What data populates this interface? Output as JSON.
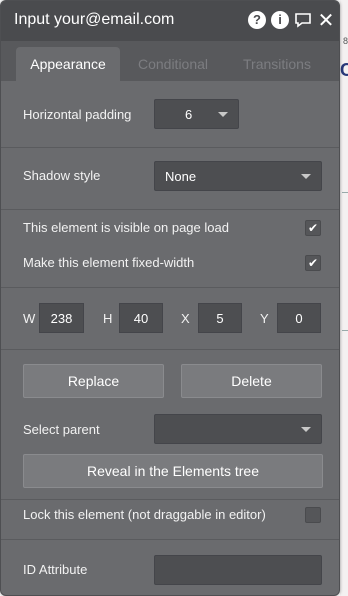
{
  "panel": {
    "title": "Input your@email.com",
    "icons": [
      "help-icon",
      "info-icon",
      "comment-icon",
      "close-icon"
    ]
  },
  "tabs": [
    {
      "label": "Appearance",
      "active": true
    },
    {
      "label": "Conditional",
      "active": false
    },
    {
      "label": "Transitions",
      "active": false
    }
  ],
  "appearance": {
    "horizontal_padding": {
      "label": "Horizontal padding",
      "value": "6"
    },
    "shadow_style": {
      "label": "Shadow style",
      "value": "None"
    },
    "visible_on_load": {
      "label": "This element is visible on page load",
      "checked": true
    },
    "fixed_width": {
      "label": "Make this element fixed-width",
      "checked": true
    },
    "dimensions": {
      "w": {
        "label": "W",
        "value": "238"
      },
      "h": {
        "label": "H",
        "value": "40"
      },
      "x": {
        "label": "X",
        "value": "5"
      },
      "y": {
        "label": "Y",
        "value": "0"
      }
    },
    "replace_label": "Replace",
    "delete_label": "Delete",
    "select_parent": {
      "label": "Select parent",
      "value": ""
    },
    "reveal_label": "Reveal in the Elements tree",
    "lock": {
      "label": "Lock this element (not draggable in editor)",
      "checked": false
    },
    "id_attribute": {
      "label": "ID Attribute",
      "value": ""
    }
  },
  "colors": {
    "panel_bg": "#6a6b6e",
    "title_bar": "#4a4b4e",
    "field_bg": "#4d4e51",
    "button_bg": "#7a7b7e"
  }
}
